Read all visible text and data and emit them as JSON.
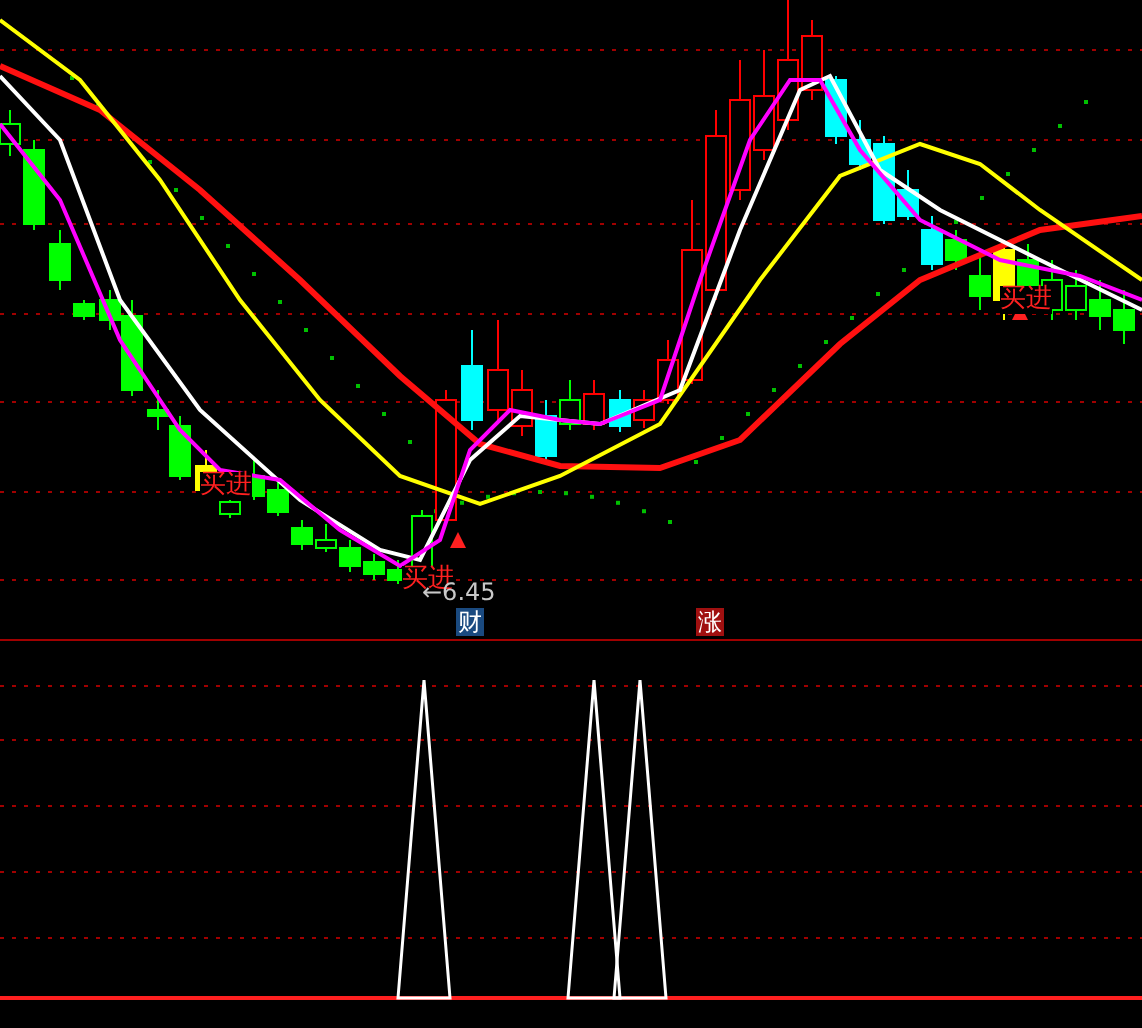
{
  "main_chart": {
    "buy_signals": [
      {
        "text": "买进"
      },
      {
        "text": "买进"
      },
      {
        "text": "买进"
      }
    ],
    "price_label": {
      "arrow": "←",
      "value": "6.45"
    },
    "badges": [
      {
        "text": "财",
        "kind": "finance"
      },
      {
        "text": "涨",
        "kind": "rise"
      }
    ]
  }
}
